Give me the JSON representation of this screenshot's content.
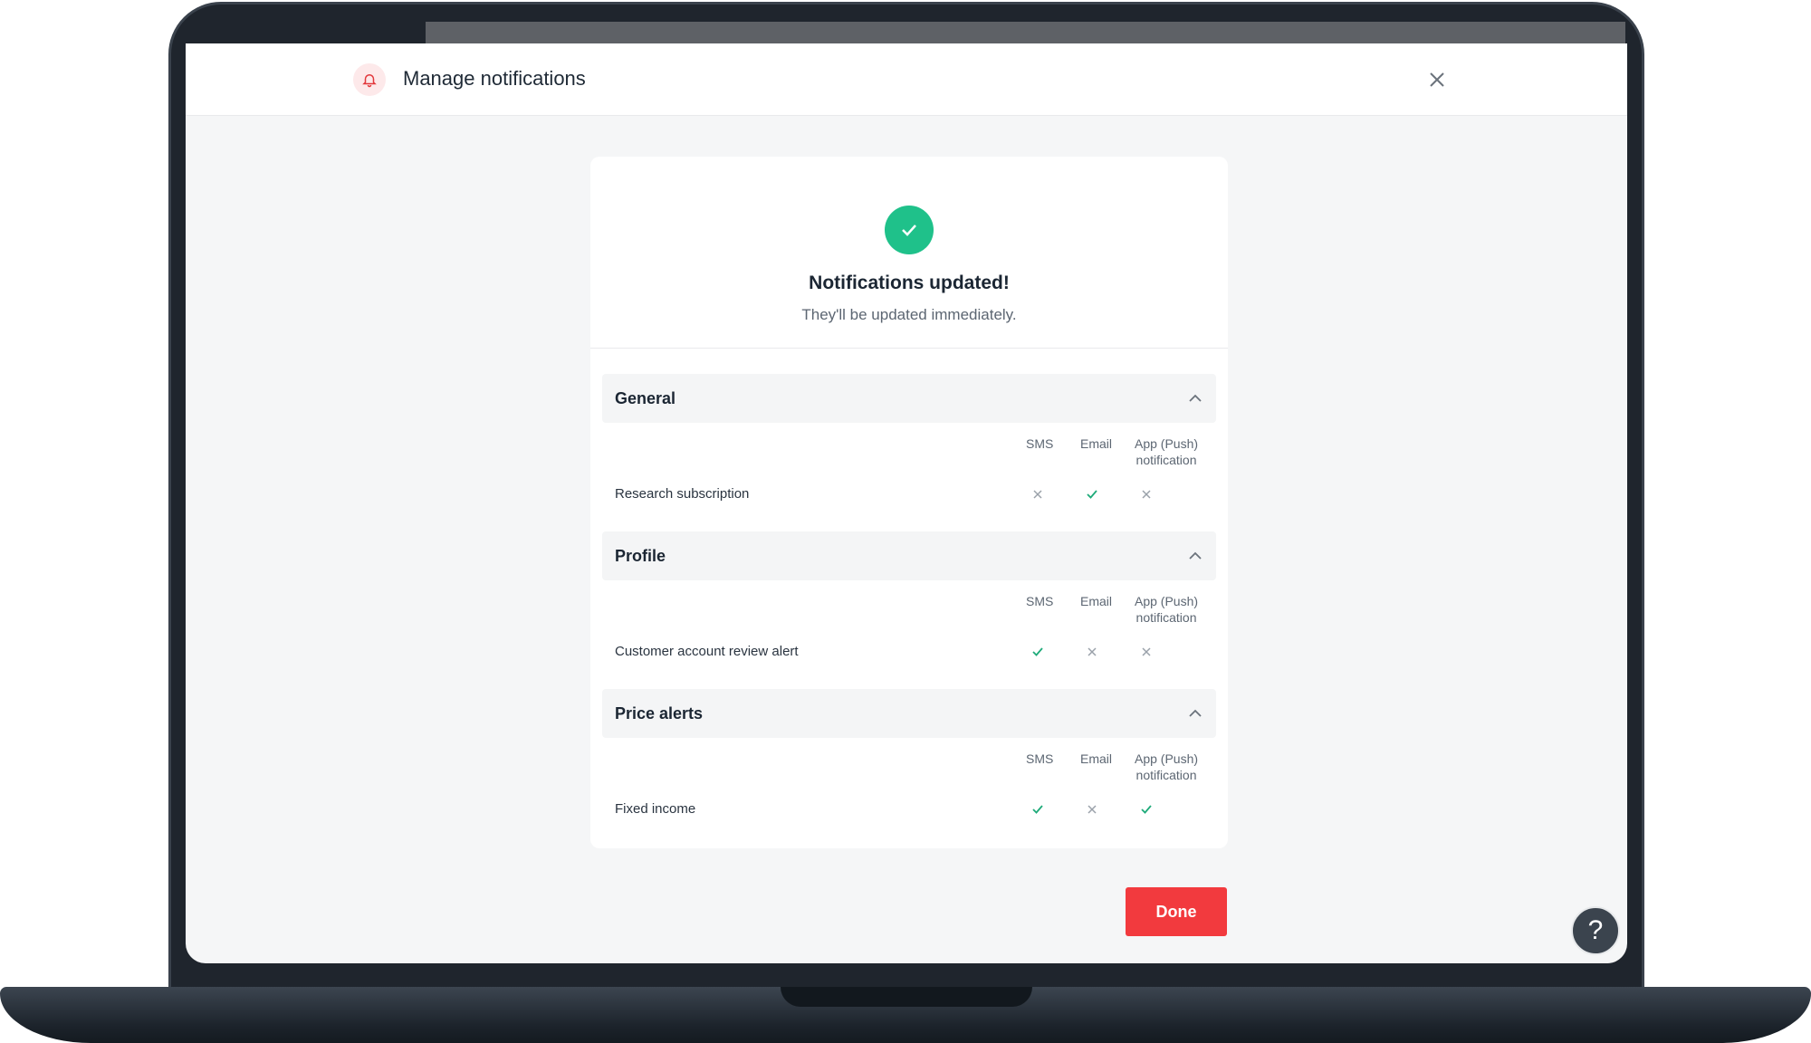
{
  "header": {
    "title": "Manage notifications",
    "bell_icon": "bell-icon",
    "close_icon": "close-icon"
  },
  "success": {
    "title": "Notifications updated!",
    "subtitle": "They'll be updated immediately."
  },
  "columns": {
    "sms": "SMS",
    "email": "Email",
    "push_line1": "App (Push)",
    "push_line2": "notification"
  },
  "sections": [
    {
      "title": "General",
      "rows": [
        {
          "label": "Research subscription",
          "sms": false,
          "email": true,
          "push": false
        }
      ]
    },
    {
      "title": "Profile",
      "rows": [
        {
          "label": "Customer account review alert",
          "sms": true,
          "email": false,
          "push": false
        }
      ]
    },
    {
      "title": "Price alerts",
      "rows": [
        {
          "label": "Fixed income",
          "sms": true,
          "email": false,
          "push": true
        }
      ]
    }
  ],
  "done_label": "Done",
  "help_label": "?",
  "colors": {
    "accent_red": "#f23a3e",
    "success_green": "#1fc18a",
    "check_green": "#1fab7a",
    "cross_gray": "#9aa1a9"
  }
}
